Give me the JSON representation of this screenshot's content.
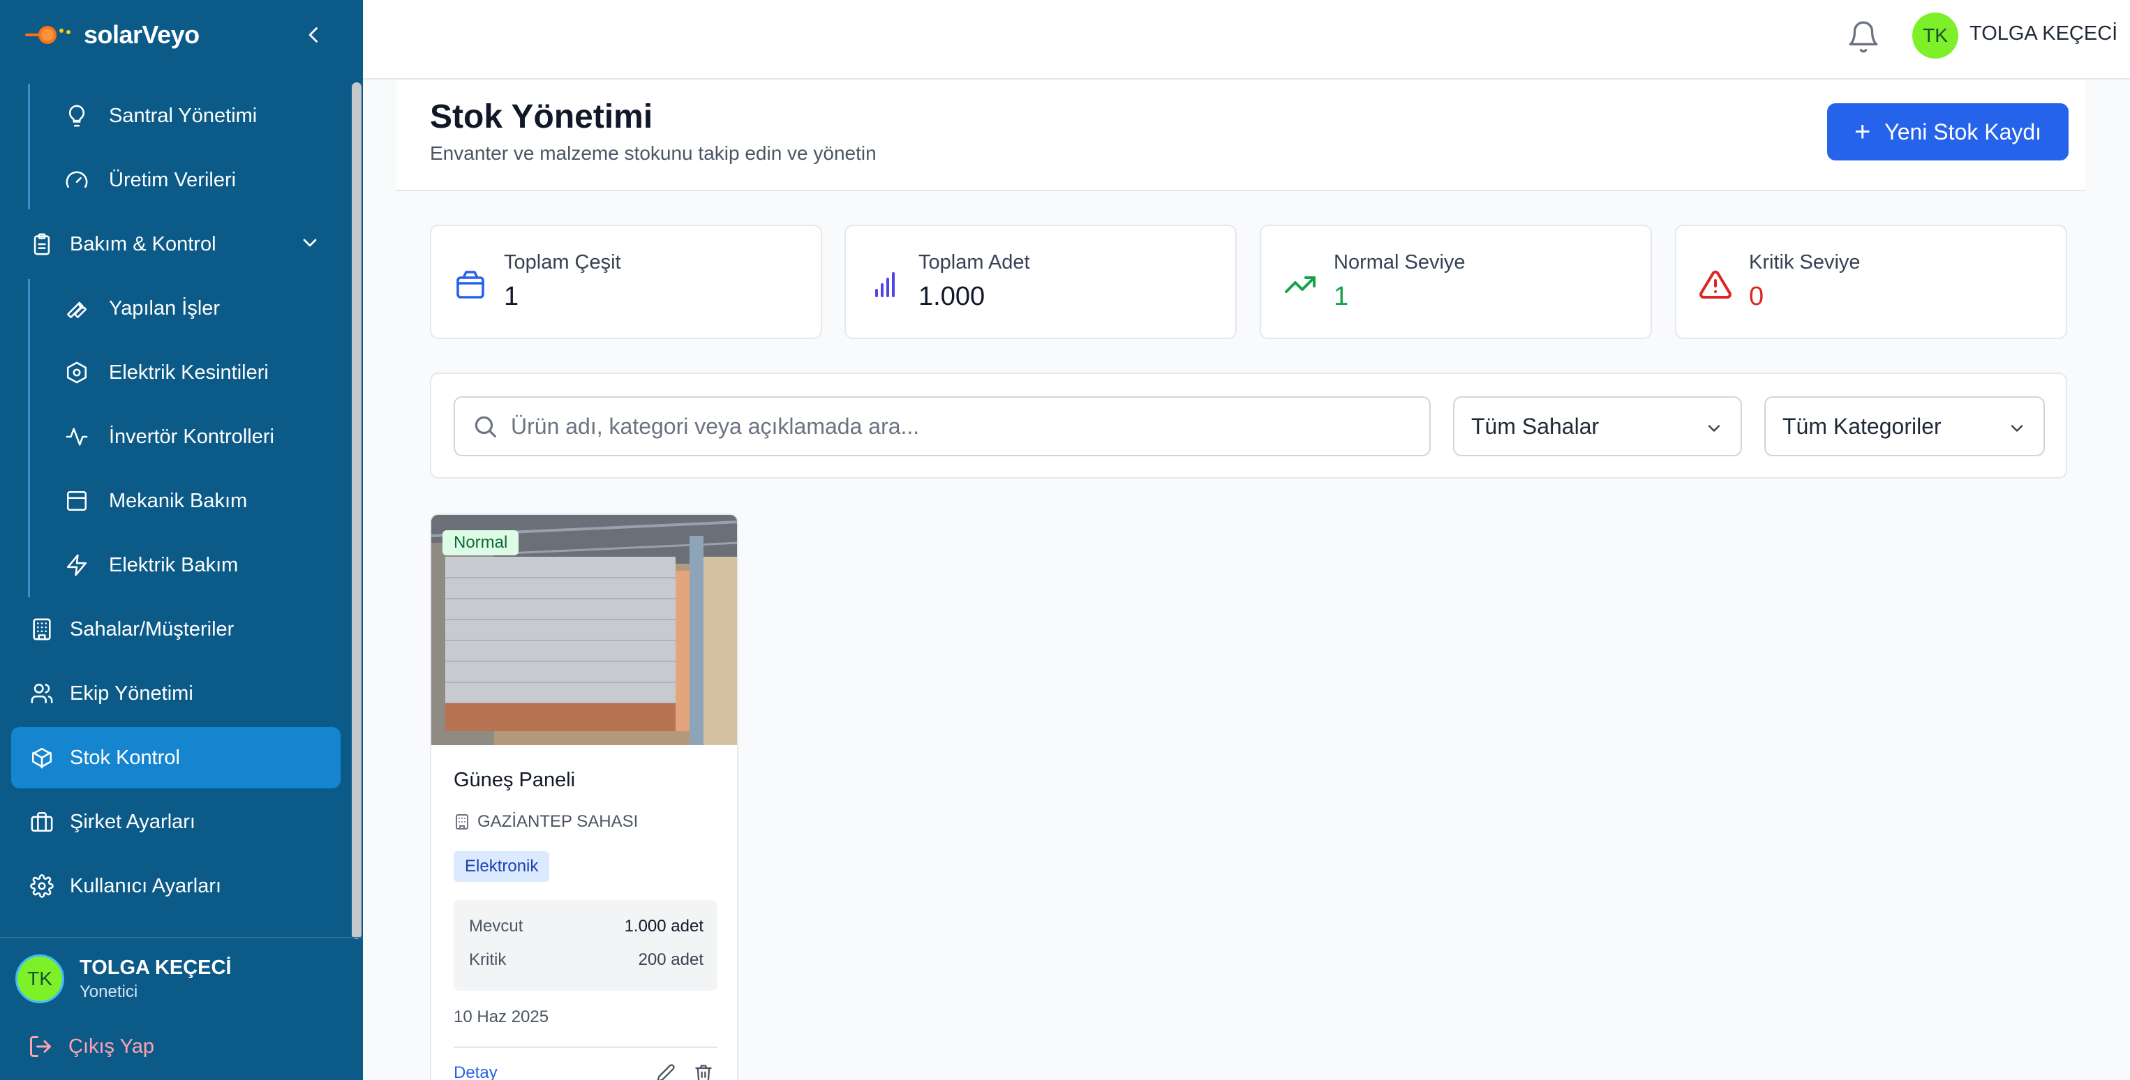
{
  "app": {
    "name": "solarVeyo"
  },
  "sidebar": {
    "items": [
      {
        "label": "Santral Yönetimi",
        "icon": "lightbulb-icon"
      },
      {
        "label": "Üretim Verileri",
        "icon": "gauge-icon"
      },
      {
        "label": "Bakım & Kontrol",
        "icon": "clipboard-icon"
      },
      {
        "label": "Yapılan İşler",
        "icon": "wrench-icon"
      },
      {
        "label": "Elektrik Kesintileri",
        "icon": "hexagon-icon"
      },
      {
        "label": "İnvertör Kontrolleri",
        "icon": "activity-icon"
      },
      {
        "label": "Mekanik Bakım",
        "icon": "panel-icon"
      },
      {
        "label": "Elektrik Bakım",
        "icon": "zap-icon"
      },
      {
        "label": "Sahalar/Müşteriler",
        "icon": "building-icon"
      },
      {
        "label": "Ekip Yönetimi",
        "icon": "users-icon"
      },
      {
        "label": "Stok Kontrol",
        "icon": "box-icon"
      },
      {
        "label": "Şirket Ayarları",
        "icon": "briefcase-icon"
      },
      {
        "label": "Kullanıcı Ayarları",
        "icon": "gear-icon"
      }
    ],
    "active": "Stok Kontrol",
    "user": {
      "initials": "TK",
      "name": "TOLGA KEÇECİ",
      "role": "Yonetici"
    },
    "logout_label": "Çıkış Yap"
  },
  "topbar": {
    "initials": "TK",
    "user_name": "TOLGA KEÇECİ"
  },
  "header": {
    "title": "Stok Yönetimi",
    "subtitle": "Envanter ve malzeme stokunu takip edin ve yönetin",
    "new_button": "Yeni Stok Kaydı"
  },
  "stats": [
    {
      "label": "Toplam Çeşit",
      "value": "1",
      "color": "#111827",
      "icon": "box-icon"
    },
    {
      "label": "Toplam Adet",
      "value": "1.000",
      "color": "#111827",
      "icon": "bar-chart-icon"
    },
    {
      "label": "Normal Seviye",
      "value": "1",
      "color": "#16a34a",
      "icon": "trending-up-icon"
    },
    {
      "label": "Kritik Seviye",
      "value": "0",
      "color": "#dc2626",
      "icon": "alert-triangle-icon"
    }
  ],
  "filters": {
    "search_placeholder": "Ürün adı, kategori veya açıklamada ara...",
    "site_select": "Tüm Sahalar",
    "category_select": "Tüm Kategoriler"
  },
  "products": [
    {
      "status": "Normal",
      "name": "Güneş Paneli",
      "site": "GAZİANTEP SAHASI",
      "category": "Elektronik",
      "current_label": "Mevcut",
      "current_value": "1.000 adet",
      "critical_label": "Kritik",
      "critical_value": "200 adet",
      "date": "10 Haz 2025",
      "detail_label": "Detay"
    }
  ],
  "colors": {
    "sidebar": "#0b5a88",
    "active": "#1585d0",
    "primary": "#2563eb",
    "avatar": "#7ef02a"
  }
}
